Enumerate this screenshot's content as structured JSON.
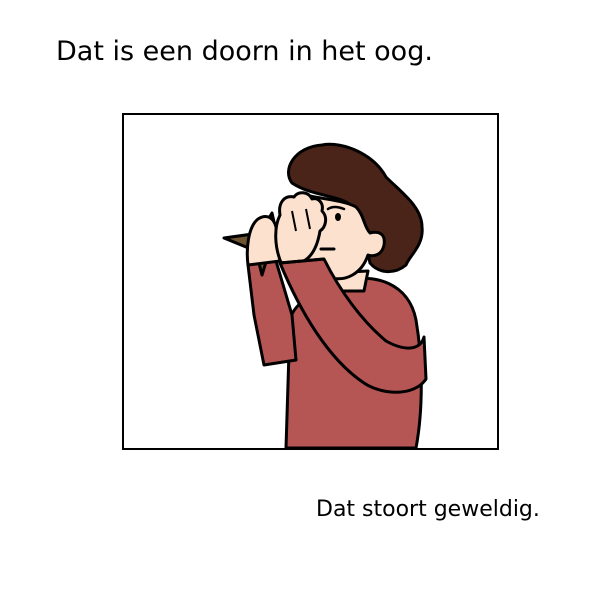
{
  "title": "Dat is een doorn in het oog.",
  "caption": "Dat stoort geweldig.",
  "colors": {
    "hair": "#4a2418",
    "skin": "#fde1cf",
    "sweater": "#b55655",
    "thorn": "#6e5530",
    "outline": "#000000"
  },
  "icons": {
    "illustration": "person-covering-eye-with-thorn"
  }
}
